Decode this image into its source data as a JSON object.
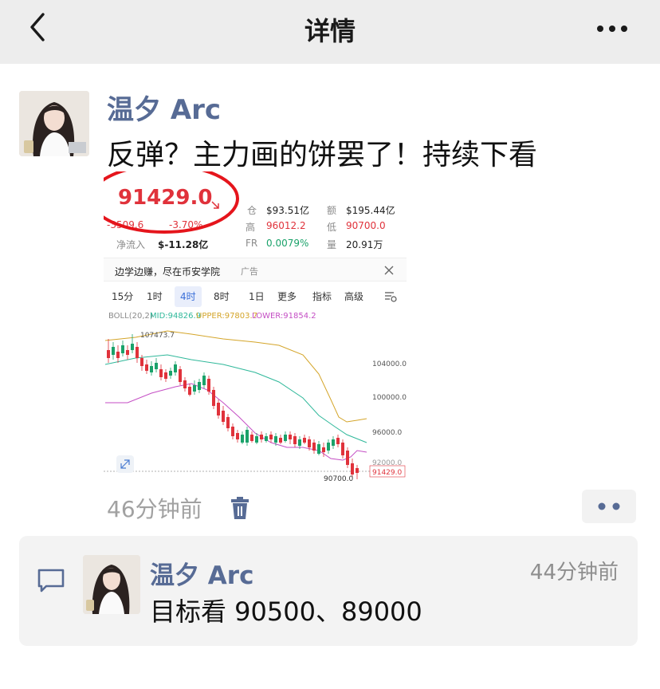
{
  "header": {
    "title": "详情",
    "back_icon": "chevron-left-icon",
    "more_icon": "more-horizontal-icon"
  },
  "post": {
    "author": "温夕 Arc",
    "text": "反弹？主力画的饼罢了！持续下看",
    "time": "46分钟前",
    "delete_icon": "trash-icon",
    "like_comment_icon": "more-dots-icon"
  },
  "screenshot": {
    "price": "91429.0",
    "change_abs": "-3509.6",
    "change_pct": "-3.70%",
    "open_interest_label": "仓",
    "open_interest": "$93.51亿",
    "amount_label": "额",
    "amount": "$195.44亿",
    "high_label": "高",
    "high": "96012.2",
    "low_label": "低",
    "low": "90700.0",
    "netflow_label": "净流入",
    "netflow": "$-11.28亿",
    "fr_label": "FR",
    "fr": "0.0079%",
    "vol_label": "量",
    "vol": "20.91万",
    "ad_text": "边学边赚，尽在币安学院",
    "ad_tag": "广告",
    "tabs": [
      "15分",
      "1时",
      "4时",
      "8时",
      "1日",
      "更多",
      "指标",
      "高级"
    ],
    "active_tab": "4时",
    "boll_label": "BOLL(20,2)",
    "boll_mid": "MID:94826.9",
    "boll_upper": "UPPER:97803.7",
    "boll_lower": "LOWER:91854.2",
    "peak_label": "107473.7",
    "low_label_chart": "90700.0",
    "current_tag": "91429.0",
    "axis_ticks": [
      "104000.0",
      "100000.0",
      "96000.0",
      "92000.0"
    ]
  },
  "comment": {
    "author": "温夕 Arc",
    "time": "44分钟前",
    "text": "目标看 90500、89000",
    "icon": "comment-icon"
  },
  "colors": {
    "link": "#576b95",
    "up": "#1aa26a",
    "down": "#e0323b",
    "annotation": "#e5151c"
  }
}
